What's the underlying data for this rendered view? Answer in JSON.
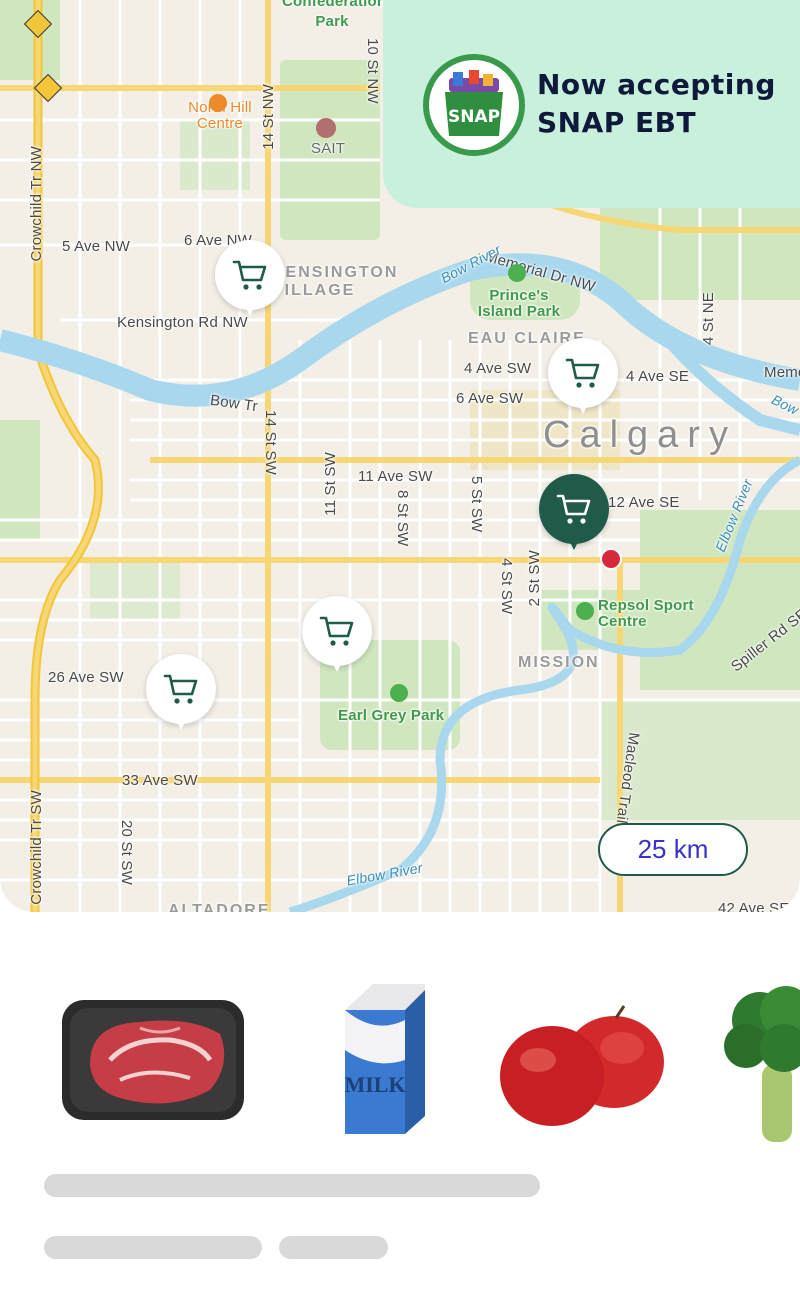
{
  "banner": {
    "line1": "Now accepting",
    "line2": "SNAP EBT",
    "logo_text": "SNAP",
    "accent": "#c9f0dc",
    "brand": "#3a9a4c"
  },
  "map": {
    "city": "Calgary",
    "scale_label": "25 km",
    "streets": {
      "ave5": "5 Ave NW",
      "ave6": "6 Ave NW",
      "kensington_rd": "Kensington Rd NW",
      "memorial": "Memorial Dr NW",
      "ave4sw": "4 Ave SW",
      "ave4se": "4 Ave SE",
      "ave6sw": "6 Ave SW",
      "bow_tr": "Bow Tr",
      "ave11": "11 Ave SW",
      "ave12": "12 Ave SE",
      "ave26": "26 Ave SW",
      "ave33": "33 Ave SW",
      "ave42": "42 Ave SE",
      "memo": "Memo",
      "st14nw": "14 St NW",
      "st10nw": "10 St NW",
      "st14sw": "14 St SW",
      "st11": "11 St SW",
      "st8": "8 St SW",
      "st5": "5 St SW",
      "st4": "4 St SW",
      "st2": "2 St SW",
      "st4ne": "4 St NE",
      "st20": "20 St SW",
      "crowchild_nw": "Crowchild Tr NW",
      "crowchild_sw": "Crowchild Tr SW",
      "macleod": "Macleod Trail S",
      "spiller": "Spiller Rd SE"
    },
    "districts": {
      "kensington": "KENSINGTON VILLAGE",
      "eau_claire": "EAU CLAIRE",
      "mission": "MISSION",
      "altadore": "ALTADORE"
    },
    "pois": {
      "north_hill": "North Hill Centre",
      "sait": "SAIT",
      "princes": "Prince's Island Park",
      "repsol": "Repsol Sport Centre",
      "earl_grey": "Earl Grey Park",
      "confed": "Confederation Park"
    },
    "rivers": {
      "bow1": "Bow River",
      "bow2": "Bow Riv",
      "elbow1": "Elbow River",
      "elbow2": "Elbow River"
    },
    "pins": [
      {
        "name": "store-pin-kensington",
        "active": false
      },
      {
        "name": "store-pin-downtown",
        "active": false
      },
      {
        "name": "store-pin-beltline",
        "active": true
      },
      {
        "name": "store-pin-mission-west",
        "active": false
      },
      {
        "name": "store-pin-26ave",
        "active": false
      }
    ]
  },
  "products": [
    {
      "name": "steak-image",
      "icon": "steak"
    },
    {
      "name": "milk-carton-image",
      "icon": "milk",
      "label": "MILK"
    },
    {
      "name": "apples-image",
      "icon": "apples"
    },
    {
      "name": "broccoli-image",
      "icon": "broccoli"
    }
  ]
}
